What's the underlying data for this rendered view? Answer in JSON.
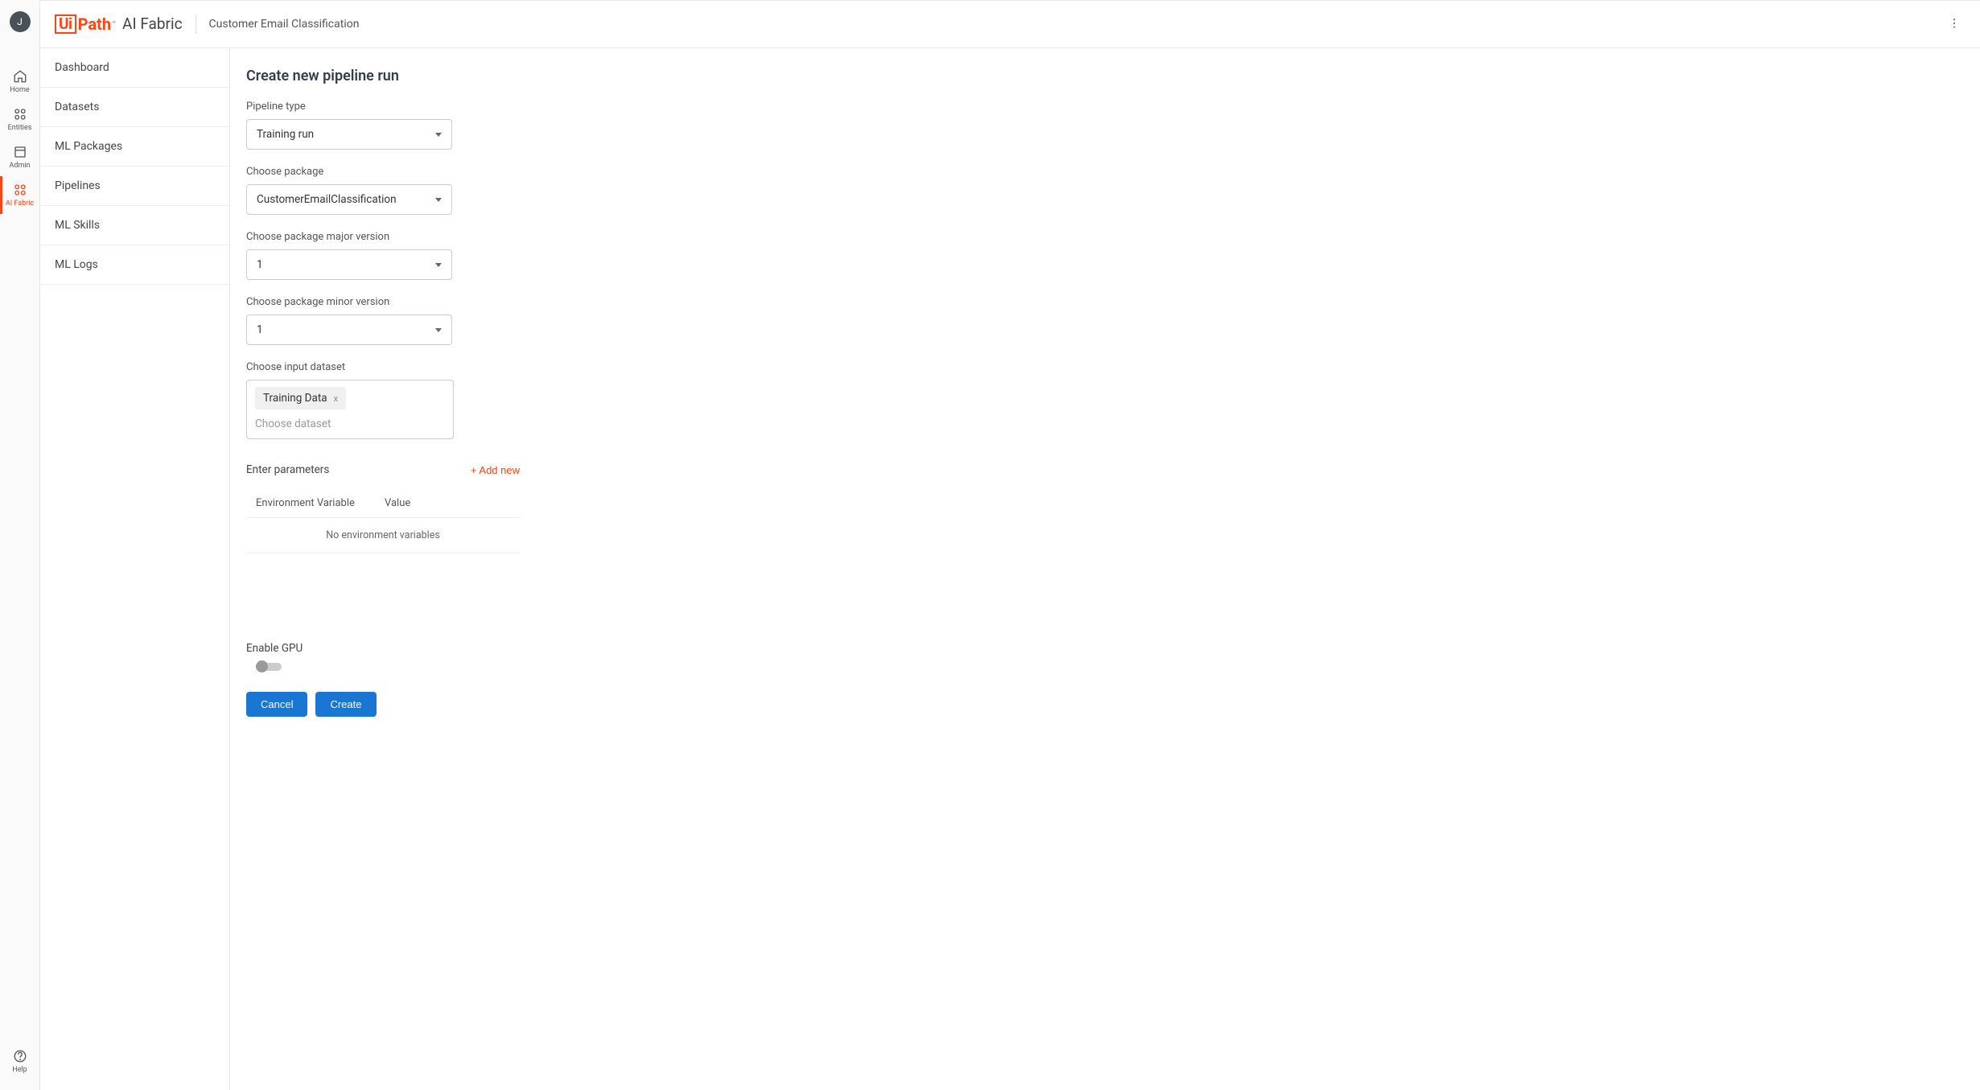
{
  "user": {
    "initial": "J"
  },
  "rail": {
    "items": [
      {
        "id": "home",
        "label": "Home"
      },
      {
        "id": "entities",
        "label": "Entities"
      },
      {
        "id": "admin",
        "label": "Admin"
      },
      {
        "id": "aifabric",
        "label": "AI Fabric"
      }
    ],
    "help": "Help"
  },
  "header": {
    "brand_ui": "Ui",
    "brand_path": "Path",
    "brand_tm": "™",
    "brand_fabric": "AI Fabric",
    "project": "Customer Email Classification"
  },
  "sidebar": {
    "items": [
      "Dashboard",
      "Datasets",
      "ML Packages",
      "Pipelines",
      "ML Skills",
      "ML Logs"
    ]
  },
  "page": {
    "title": "Create new pipeline run",
    "fields": {
      "pipeline_type": {
        "label": "Pipeline type",
        "value": "Training run"
      },
      "package": {
        "label": "Choose package",
        "value": "CustomerEmailClassification"
      },
      "major": {
        "label": "Choose package major version",
        "value": "1"
      },
      "minor": {
        "label": "Choose package minor version",
        "value": "1"
      },
      "dataset": {
        "label": "Choose input dataset",
        "chip": "Training Data",
        "placeholder": "Choose dataset"
      }
    },
    "params": {
      "title": "Enter parameters",
      "add_new": "+ Add new",
      "col_env": "Environment Variable",
      "col_val": "Value",
      "empty": "No environment variables"
    },
    "gpu_label": "Enable GPU",
    "buttons": {
      "cancel": "Cancel",
      "create": "Create"
    }
  }
}
